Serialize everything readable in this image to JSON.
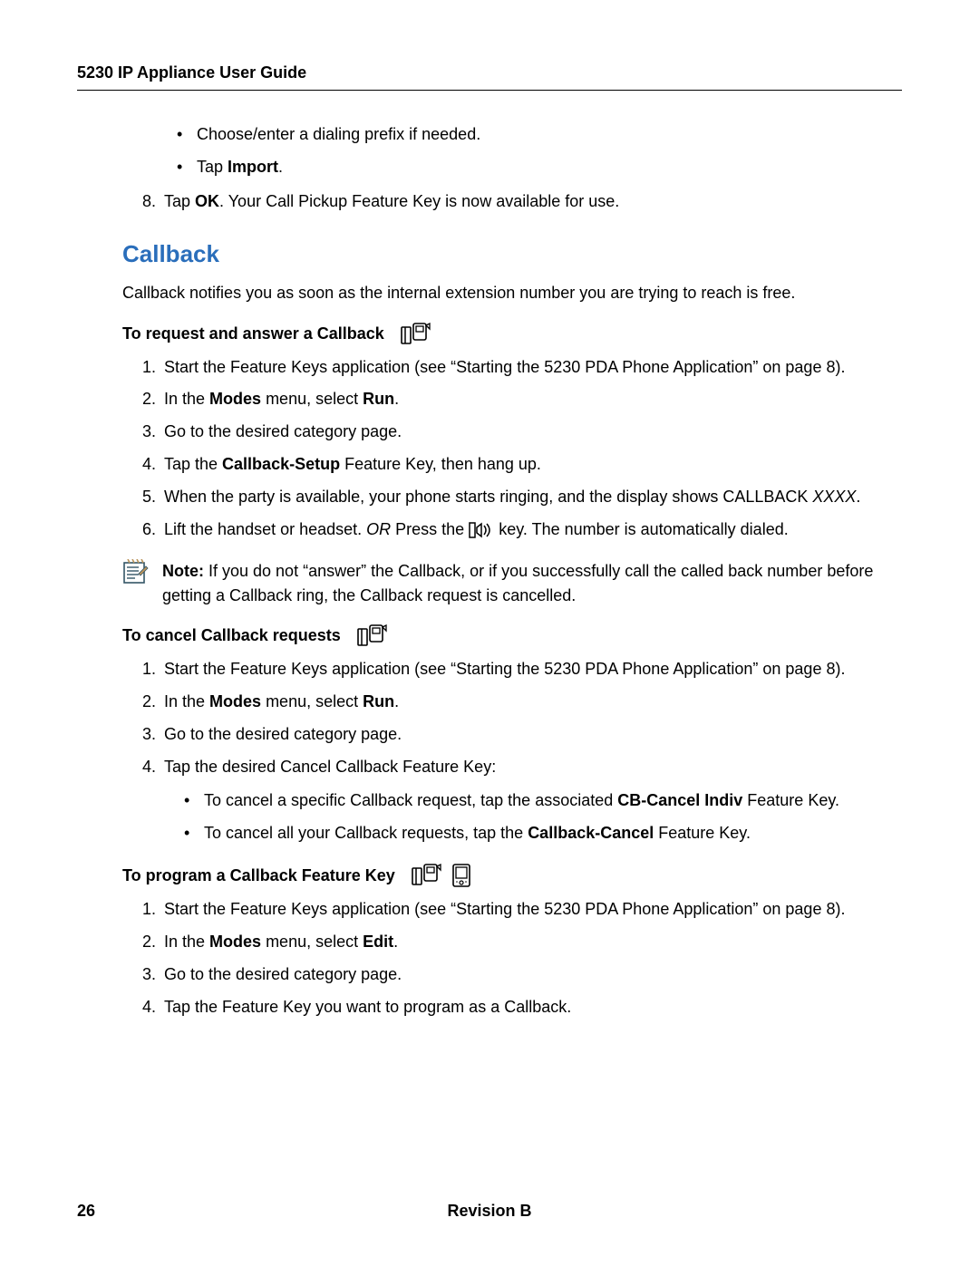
{
  "header": {
    "title": "5230 IP Appliance User Guide"
  },
  "intro_bullets": [
    {
      "text": "Choose/enter a dialing prefix if needed."
    },
    {
      "prefix": "Tap ",
      "bold": "Import",
      "suffix": "."
    }
  ],
  "step8": {
    "prefix": "Tap ",
    "bold": "OK",
    "suffix": ". Your Call Pickup Feature Key is now available for use."
  },
  "section": {
    "title": "Callback",
    "intro": "Callback notifies you as soon as the internal extension number you are trying to reach is free."
  },
  "request": {
    "heading": "To request and answer a Callback",
    "s1": "Start the Feature Keys application (see “Starting the 5230 PDA Phone Application” on page 8).",
    "s2_a": "In the ",
    "s2_b": "Modes",
    "s2_c": " menu, select ",
    "s2_d": "Run",
    "s2_e": ".",
    "s3": "Go to the desired category page.",
    "s4_a": "Tap the ",
    "s4_b": "Callback-Setup",
    "s4_c": " Feature Key, then hang up.",
    "s5_a": "When the party is available, your phone starts ringing, and the display shows CALLBACK ",
    "s5_b": "XXXX",
    "s5_c": ".",
    "s6_a": "Lift the handset or headset.  ",
    "s6_b": "OR",
    "s6_c": "  Press the ",
    "s6_d": " key. The number is automatically dialed."
  },
  "note": {
    "label": "Note:",
    "text": " If you do not “answer” the Callback, or if you successfully call the called back number before getting a Callback ring, the Callback request is cancelled."
  },
  "cancel": {
    "heading": "To cancel Callback requests",
    "s1": "Start the Feature Keys application (see “Starting the 5230 PDA Phone Application” on page 8).",
    "s2_a": "In the ",
    "s2_b": "Modes",
    "s2_c": " menu, select ",
    "s2_d": "Run",
    "s2_e": ".",
    "s3": "Go to the desired category page.",
    "s4": "Tap the desired Cancel Callback Feature Key:",
    "b1_a": "To cancel a specific Callback request, tap the associated ",
    "b1_b": "CB-Cancel Indiv",
    "b1_c": " Feature Key.",
    "b2_a": "To cancel all your Callback requests, tap the ",
    "b2_b": "Callback-Cancel",
    "b2_c": " Feature Key."
  },
  "program": {
    "heading": "To program a Callback Feature Key",
    "s1": "Start the Feature Keys application (see “Starting the 5230 PDA Phone Application” on page 8).",
    "s2_a": "In the ",
    "s2_b": "Modes",
    "s2_c": " menu, select ",
    "s2_d": "Edit",
    "s2_e": ".",
    "s3": "Go to the desired category page.",
    "s4": "Tap the Feature Key you want to program as a Callback."
  },
  "footer": {
    "page": "26",
    "rev": "Revision B"
  }
}
